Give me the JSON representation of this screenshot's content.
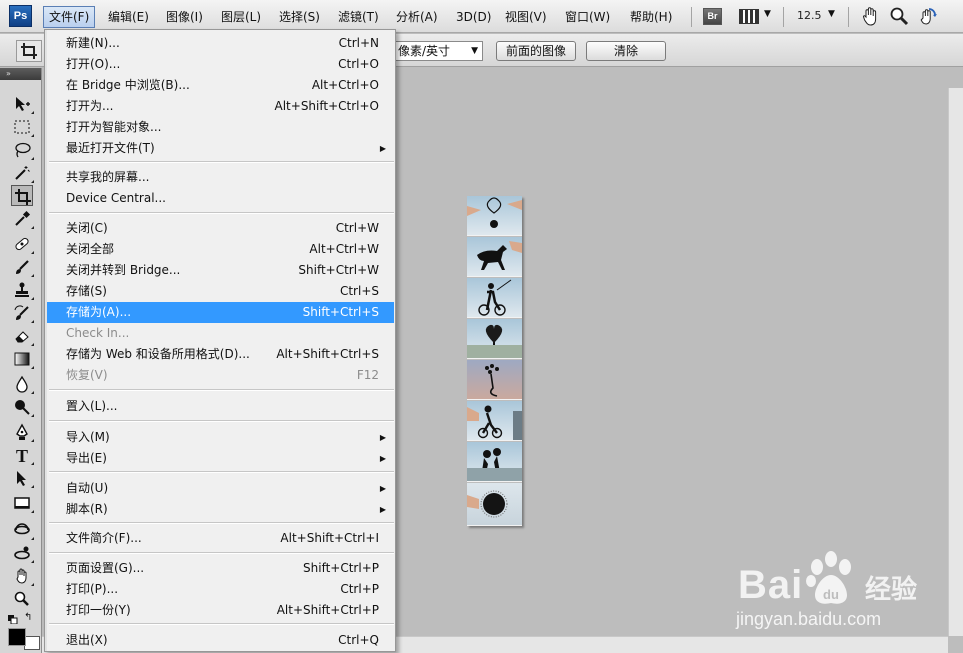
{
  "menubar": {
    "items": [
      "文件(F)",
      "编辑(E)",
      "图像(I)",
      "图层(L)",
      "选择(S)",
      "滤镜(T)",
      "分析(A)",
      "3D(D)",
      "视图(V)",
      "窗口(W)",
      "帮助(H)"
    ],
    "app_logo": "Ps",
    "bridge_button": "Br",
    "zoom_value": "12.5",
    "icons": [
      "hand-icon",
      "zoom-icon",
      "rotate-view-icon"
    ]
  },
  "options": {
    "units_value": "像素/英寸",
    "front_image_button": "前面的图像",
    "clear_button": "清除"
  },
  "file_menu": {
    "items": [
      {
        "label": "新建(N)...",
        "shortcut": "Ctrl+N"
      },
      {
        "label": "打开(O)...",
        "shortcut": "Ctrl+O"
      },
      {
        "label": "在 Bridge 中浏览(B)...",
        "shortcut": "Alt+Ctrl+O"
      },
      {
        "label": "打开为...",
        "shortcut": "Alt+Shift+Ctrl+O"
      },
      {
        "label": "打开为智能对象...",
        "shortcut": ""
      },
      {
        "label": "最近打开文件(T)",
        "shortcut": "",
        "submenu": true
      },
      {
        "label": "共享我的屏幕...",
        "shortcut": ""
      },
      {
        "label": "Device Central...",
        "shortcut": ""
      },
      {
        "label": "关闭(C)",
        "shortcut": "Ctrl+W"
      },
      {
        "label": "关闭全部",
        "shortcut": "Alt+Ctrl+W"
      },
      {
        "label": "关闭并转到 Bridge...",
        "shortcut": "Shift+Ctrl+W"
      },
      {
        "label": "存储(S)",
        "shortcut": "Ctrl+S"
      },
      {
        "label": "存储为(A)...",
        "shortcut": "Shift+Ctrl+S",
        "highlighted": true
      },
      {
        "label": "Check In...",
        "shortcut": "",
        "disabled": true
      },
      {
        "label": "存储为 Web 和设备所用格式(D)...",
        "shortcut": "Alt+Shift+Ctrl+S"
      },
      {
        "label": "恢复(V)",
        "shortcut": "F12",
        "disabled": true
      },
      {
        "label": "置入(L)...",
        "shortcut": ""
      },
      {
        "label": "导入(M)",
        "shortcut": "",
        "submenu": true
      },
      {
        "label": "导出(E)",
        "shortcut": "",
        "submenu": true
      },
      {
        "label": "自动(U)",
        "shortcut": "",
        "submenu": true
      },
      {
        "label": "脚本(R)",
        "shortcut": "",
        "submenu": true
      },
      {
        "label": "文件简介(F)...",
        "shortcut": "Alt+Shift+Ctrl+I"
      },
      {
        "label": "页面设置(G)...",
        "shortcut": "Shift+Ctrl+P"
      },
      {
        "label": "打印(P)...",
        "shortcut": "Ctrl+P"
      },
      {
        "label": "打印一份(Y)",
        "shortcut": "Alt+Shift+Ctrl+P"
      },
      {
        "label": "退出(X)",
        "shortcut": "Ctrl+Q"
      }
    ]
  },
  "toolbox": {
    "tools": [
      "move-tool",
      "marquee-tool",
      "lasso-tool",
      "magic-wand-tool",
      "crop-tool",
      "eyedropper-tool",
      "healing-brush-tool",
      "brush-tool",
      "clone-stamp-tool",
      "history-brush-tool",
      "eraser-tool",
      "gradient-tool",
      "blur-tool",
      "dodge-tool",
      "pen-tool",
      "type-tool",
      "path-selection-tool",
      "shape-tool",
      "3d-rotate-tool",
      "3d-orbit-tool",
      "hand-tool",
      "zoom-tool"
    ],
    "selected_tool": "crop-tool"
  },
  "watermark": {
    "brand": "Bai",
    "brand_cn": "经验",
    "url": "jingyan.baidu.com"
  }
}
